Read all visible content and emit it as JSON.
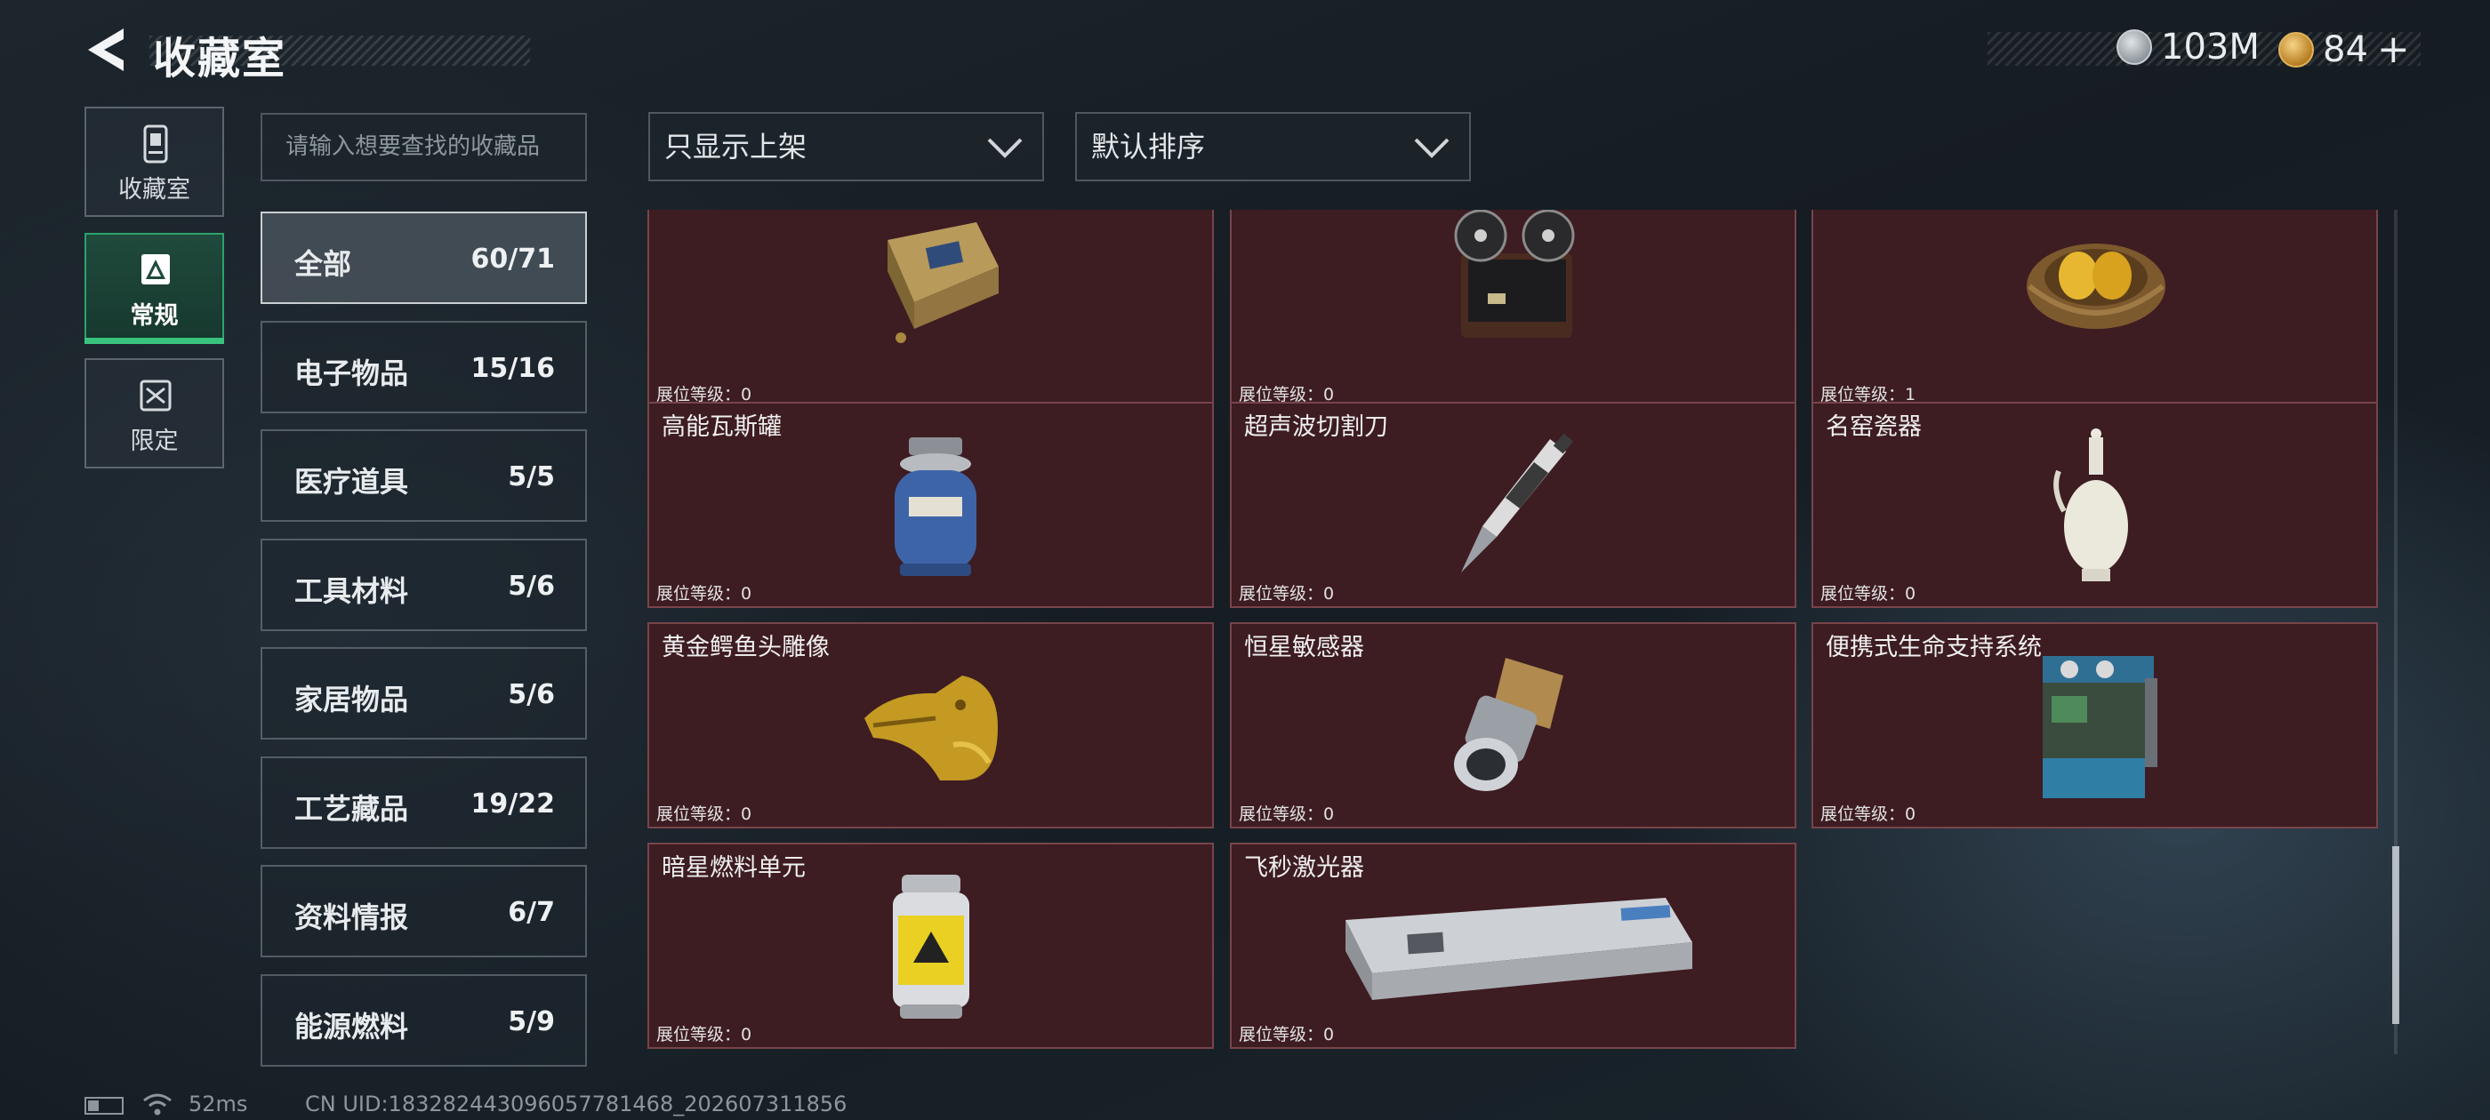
{
  "header": {
    "title": "收藏室",
    "currency": [
      {
        "icon": "silver-coin-icon",
        "value": "103M"
      },
      {
        "icon": "gold-coin-icon",
        "value": "84"
      }
    ],
    "add_symbol": "+"
  },
  "side_tabs": [
    {
      "label": "收藏室",
      "icon": "collection-icon",
      "active": false
    },
    {
      "label": "常规",
      "icon": "regular-icon",
      "active": true
    },
    {
      "label": "限定",
      "icon": "limited-icon",
      "active": false
    }
  ],
  "search": {
    "placeholder": "请输入想要查找的收藏品"
  },
  "filters": {
    "display": "只显示上架",
    "sort": "默认排序"
  },
  "categories": [
    {
      "name": "全部",
      "count": "60/71",
      "active": true
    },
    {
      "name": "电子物品",
      "count": "15/16"
    },
    {
      "name": "医疗道具",
      "count": "5/5"
    },
    {
      "name": "工具材料",
      "count": "5/6"
    },
    {
      "name": "家居物品",
      "count": "5/6"
    },
    {
      "name": "工艺藏品",
      "count": "19/22"
    },
    {
      "name": "资料情报",
      "count": "6/7"
    },
    {
      "name": "能源燃料",
      "count": "5/9"
    }
  ],
  "items": [
    {
      "name": "",
      "level": "展位等级：0",
      "icon": "electronic-module-icon"
    },
    {
      "name": "",
      "level": "展位等级：0",
      "icon": "reel-tape-recorder-icon"
    },
    {
      "name": "",
      "level": "展位等级：1",
      "icon": "golden-eggs-nest-icon"
    },
    {
      "name": "高能瓦斯罐",
      "level": "展位等级：0",
      "icon": "gas-canister-icon"
    },
    {
      "name": "超声波切割刀",
      "level": "展位等级：0",
      "icon": "ultrasonic-cutter-icon"
    },
    {
      "name": "名窑瓷器",
      "level": "展位等级：0",
      "icon": "porcelain-vase-icon"
    },
    {
      "name": "黄金鳄鱼头雕像",
      "level": "展位等级：0",
      "icon": "golden-crocodile-statue-icon"
    },
    {
      "name": "恒星敏感器",
      "level": "展位等级：0",
      "icon": "star-sensor-icon"
    },
    {
      "name": "便携式生命支持系统",
      "level": "展位等级：0",
      "icon": "life-support-system-icon"
    },
    {
      "name": "暗星燃料单元",
      "level": "展位等级：0",
      "icon": "fuel-cell-icon"
    },
    {
      "name": "飞秒激光器",
      "level": "展位等级：0",
      "icon": "femtosecond-laser-icon"
    }
  ],
  "status_bar": {
    "ping": "52ms",
    "uid": "CN UID:1832824430960577814​68_202607311856"
  }
}
